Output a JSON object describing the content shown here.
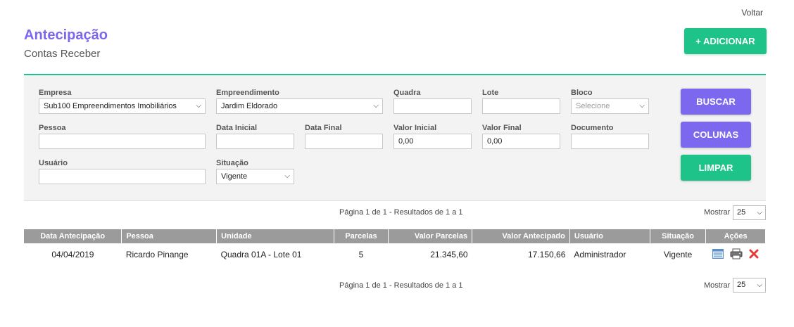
{
  "nav": {
    "back_label": "Voltar"
  },
  "header": {
    "title": "Antecipação",
    "subtitle": "Contas Receber",
    "add_label": "+ ADICIONAR"
  },
  "filters": {
    "empresa": {
      "label": "Empresa",
      "value": "Sub100 Empreendimentos Imobiliários"
    },
    "empreendimento": {
      "label": "Empreendimento",
      "value": "Jardim Eldorado"
    },
    "quadra": {
      "label": "Quadra",
      "value": ""
    },
    "lote": {
      "label": "Lote",
      "value": ""
    },
    "bloco": {
      "label": "Bloco",
      "value": "Selecione"
    },
    "pessoa": {
      "label": "Pessoa",
      "value": ""
    },
    "data_inicial": {
      "label": "Data Inicial",
      "value": ""
    },
    "data_final": {
      "label": "Data Final",
      "value": ""
    },
    "valor_inicial": {
      "label": "Valor Inicial",
      "value": "0,00"
    },
    "valor_final": {
      "label": "Valor Final",
      "value": "0,00"
    },
    "documento": {
      "label": "Documento",
      "value": ""
    },
    "usuario": {
      "label": "Usuário",
      "value": ""
    },
    "situacao": {
      "label": "Situação",
      "value": "Vigente"
    }
  },
  "buttons": {
    "buscar": "BUSCAR",
    "colunas": "COLUNAS",
    "limpar": "LIMPAR"
  },
  "pagination": {
    "text": "Página 1 de 1 - Resultados de 1 a 1",
    "show_label": "Mostrar",
    "page_size": "25"
  },
  "table": {
    "columns": [
      "Data Antecipação",
      "Pessoa",
      "Unidade",
      "Parcelas",
      "Valor Parcelas",
      "Valor Antecipado",
      "Usuário",
      "Situação",
      "Ações"
    ],
    "rows": [
      [
        "04/04/2019",
        "Ricardo Pinange",
        "Quadra 01A - Lote 01",
        "5",
        "21.345,60",
        "17.150,66",
        "Administrador",
        "Vigente"
      ]
    ]
  },
  "colors": {
    "accent_purple": "#7b68ee",
    "accent_green": "#1ec38a",
    "header_gray": "#9b9b9b",
    "delete_red": "#e53935"
  },
  "icons": {
    "view": "list-icon",
    "print": "printer-icon",
    "delete": "delete-x-icon"
  }
}
